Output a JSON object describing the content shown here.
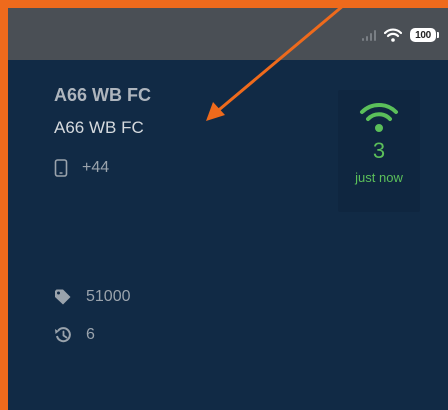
{
  "status_bar": {
    "battery": "100",
    "icons": [
      "signal-icon",
      "wifi-icon",
      "battery-icon"
    ]
  },
  "detail": {
    "name_primary": "A66 WB FC",
    "name_secondary": "A66 WB FC",
    "phone": "+44",
    "price": "51000",
    "history_count": "6"
  },
  "wifi_status": {
    "count": "3",
    "time": "just now"
  },
  "colors": {
    "background": "#112a45",
    "status_bar": "#4a4f55",
    "accent_green": "#5bbf5a",
    "annotation": "#ee6a1c"
  },
  "icons": [
    "phone-icon",
    "tag-icon",
    "history-icon",
    "wifi-signal-icon"
  ]
}
